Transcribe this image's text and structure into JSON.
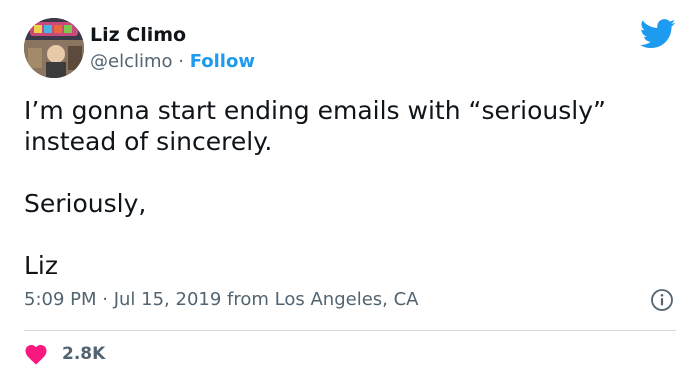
{
  "author": {
    "display_name": "Liz Climo",
    "handle": "@elclimo",
    "separator": " · ",
    "follow_label": "Follow"
  },
  "tweet": {
    "lines": [
      "I’m gonna start ending emails with “seriously” instead of sincerely.",
      "Seriously,",
      "Liz"
    ],
    "time": "5:09 PM",
    "date": "Jul 15, 2019",
    "source": "from Los Angeles, CA",
    "meta_separator": " · "
  },
  "engagement": {
    "likes": "2.8K"
  },
  "icons": {
    "brand": "twitter-bird-icon",
    "info": "info-icon",
    "like": "heart-icon"
  },
  "colors": {
    "brand_blue": "#1d9bf0",
    "heart_pink": "#f91880",
    "text_primary": "#0f1419",
    "text_secondary": "#536471"
  }
}
